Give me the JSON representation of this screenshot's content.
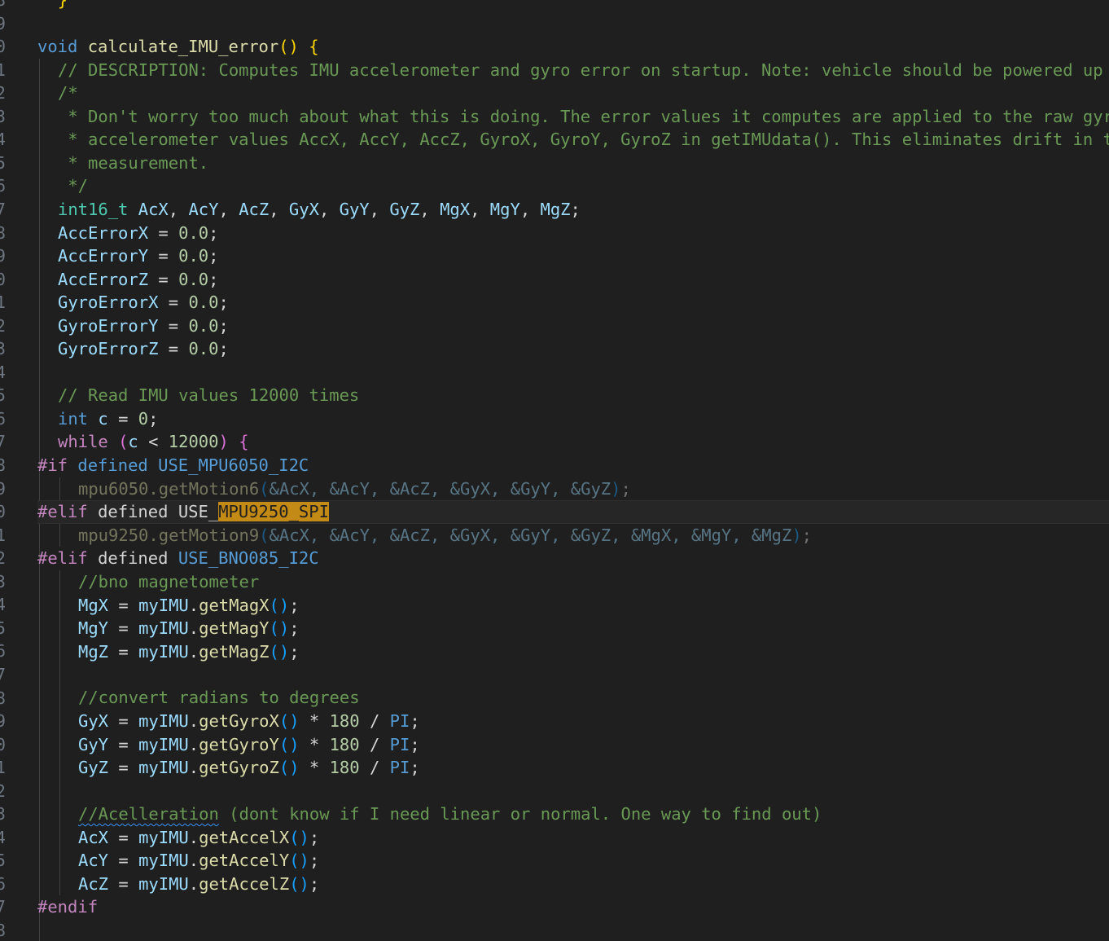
{
  "gutter": {
    "line_numbers": [
      "8",
      "9",
      "0",
      "1",
      "2",
      "3",
      "4",
      "5",
      "6",
      "7",
      "8",
      "9",
      "0",
      "1",
      "2",
      "3",
      "4",
      "5",
      "6",
      "7",
      "8",
      "9",
      "0",
      "1",
      "2",
      "3",
      "4",
      "5",
      "6",
      "7",
      "8",
      "9",
      "0",
      "1",
      "2",
      "3",
      "4",
      "5",
      "6",
      "7",
      "8"
    ]
  },
  "code": {
    "l_closing": "}",
    "fn_void": "void",
    "fn_name": "calculate_IMU_error",
    "fn_parens": "()",
    "fn_brace": "{",
    "desc_comment": "// DESCRIPTION: Computes IMU accelerometer and gyro error on startup. Note: vehicle should be powered up on flat surface",
    "block_open": "/*",
    "block_1": " * Don't worry too much about what this is doing. The error values it computes are applied to the raw gyro and",
    "block_2": " * accelerometer values AccX, AccY, AccZ, GyroX, GyroY, GyroZ in getIMUdata(). This eliminates drift in the",
    "block_3": " * measurement.",
    "block_close": " */",
    "decl_type": "int16_t",
    "decl_vars": [
      {
        "name": "AcX",
        "sep": ", "
      },
      {
        "name": "AcY",
        "sep": ", "
      },
      {
        "name": "AcZ",
        "sep": ", "
      },
      {
        "name": "GyX",
        "sep": ", "
      },
      {
        "name": "GyY",
        "sep": ", "
      },
      {
        "name": "GyZ",
        "sep": ", "
      },
      {
        "name": "MgX",
        "sep": ", "
      },
      {
        "name": "MgY",
        "sep": ", "
      },
      {
        "name": "MgZ",
        "sep": ";"
      }
    ],
    "assigns": [
      {
        "name": "AccErrorX",
        "value": "0.0"
      },
      {
        "name": "AccErrorY",
        "value": "0.0"
      },
      {
        "name": "AccErrorZ",
        "value": "0.0"
      },
      {
        "name": "GyroErrorX",
        "value": "0.0"
      },
      {
        "name": "GyroErrorY",
        "value": "0.0"
      },
      {
        "name": "GyroErrorZ",
        "value": "0.0"
      }
    ],
    "read_comment": "// Read IMU values 12000 times",
    "int_kw": "int",
    "c_var": "c",
    "zero": "0",
    "while_kw": "while",
    "limit": "12000",
    "if_directive": "#if",
    "defined_kw": "defined",
    "use_mpu6050": "USE_MPU6050_I2C",
    "mpu6050_call": "mpu6050.getMotion6",
    "mpu6050_args": "&AcX, &AcY, &AcZ, &GyX, &GyY, &GyZ",
    "elif_directive": "#elif",
    "use_prefix": "USE_",
    "use_mpu9250_hl": "MPU9250_SPI",
    "mpu9250_call": "mpu9250.getMotion9",
    "mpu9250_args": "&AcX, &AcY, &AcZ, &GyX, &GyY, &GyZ, &MgX, &MgY, &MgZ",
    "use_bno085": "USE_BNO085_I2C",
    "bno_comment": "//bno magnetometer",
    "obj": "myIMU",
    "mag_calls": [
      {
        "lhs": "MgX",
        "method": "getMagX"
      },
      {
        "lhs": "MgY",
        "method": "getMagY"
      },
      {
        "lhs": "MgZ",
        "method": "getMagZ"
      }
    ],
    "convert_comment": "//convert radians to degrees",
    "gyro_calls": [
      {
        "lhs": "GyX",
        "method": "getGyroX"
      },
      {
        "lhs": "GyY",
        "method": "getGyroY"
      },
      {
        "lhs": "GyZ",
        "method": "getGyroZ"
      }
    ],
    "deg_factor": "180",
    "pi": "PI",
    "accel_comment_word": "//Acelleration",
    "accel_comment_rest": " (dont know if I need linear or normal. One way to find out)",
    "accel_calls": [
      {
        "lhs": "AcX",
        "method": "getAccelX"
      },
      {
        "lhs": "AcY",
        "method": "getAccelY"
      },
      {
        "lhs": "AcZ",
        "method": "getAccelZ"
      }
    ],
    "endif_directive": "#endif"
  },
  "colors": {
    "background": "#1f1f1f",
    "keyword": "#569cd6",
    "function": "#dcdcaa",
    "variable": "#9cdcfe",
    "type": "#4ec9b0",
    "number": "#b5cea8",
    "comment": "#6a9955",
    "preprocessor": "#c586c0",
    "find_highlight": "#c38a15"
  }
}
